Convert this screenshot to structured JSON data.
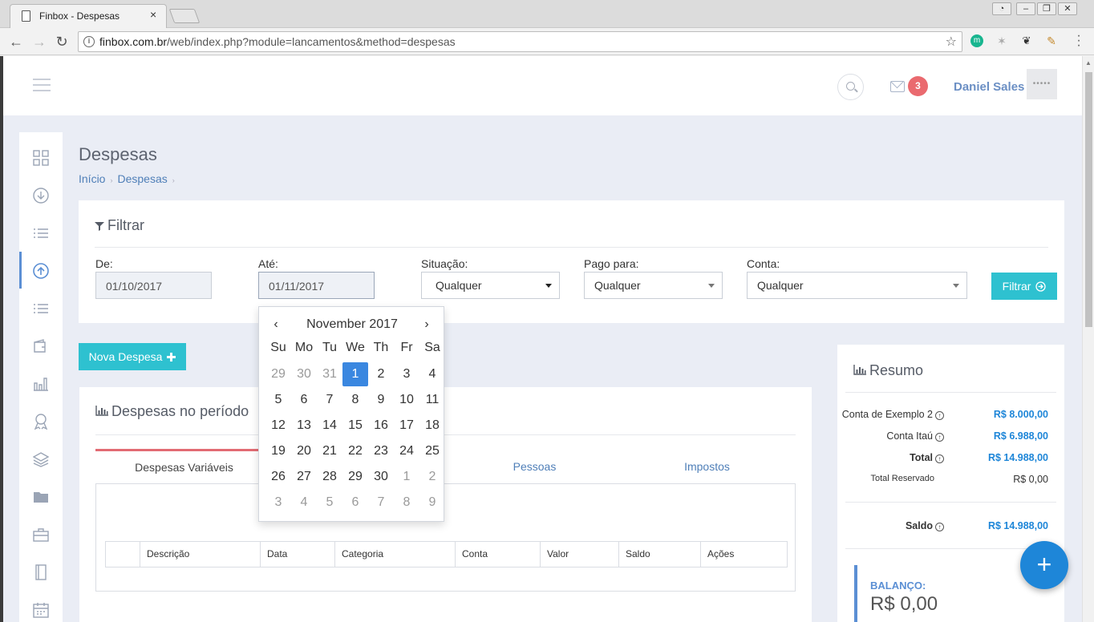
{
  "browser": {
    "tab_title": "Finbox - Despesas",
    "tab_close": "×",
    "url_host": "finbox.com.br",
    "url_path": "/web/index.php?module=lancamentos&method=despesas"
  },
  "header": {
    "notification_count": "3",
    "user_name": "Daniel Sales",
    "avatar_text": "•••••"
  },
  "page": {
    "title": "Despesas",
    "breadcrumb": [
      "Início",
      "Despesas"
    ]
  },
  "filter": {
    "title": "Filtrar",
    "de_label": "De:",
    "de_value": "01/10/2017",
    "ate_label": "Até:",
    "ate_value": "01/11/2017",
    "situacao_label": "Situação:",
    "situacao_value": "Qualquer",
    "pago_label": "Pago para:",
    "pago_value": "Qualquer",
    "conta_label": "Conta:",
    "conta_value": "Qualquer",
    "button": "Filtrar"
  },
  "nova_despesa": "Nova Despesa",
  "despesas_card": {
    "title": "Despesas no período",
    "tabs": [
      "Despesas Variáveis",
      "Pessoas",
      "Impostos"
    ],
    "columns": [
      "Descrição",
      "Data",
      "Categoria",
      "Conta",
      "Valor",
      "Saldo",
      "Ações"
    ]
  },
  "resumo": {
    "title": "Resumo",
    "rows": [
      {
        "label": "Conta de Exemplo 2",
        "value": "R$ 8.000,00"
      },
      {
        "label": "Conta Itaú",
        "value": "R$ 6.988,00"
      },
      {
        "label": "Total",
        "value": "R$ 14.988,00"
      },
      {
        "label": "Total Reservado",
        "value": "R$ 0,00"
      }
    ],
    "saldo_label": "Saldo",
    "saldo_value": "R$ 14.988,00",
    "balanco_label": "BALANÇO:",
    "balanco_value": "R$ 0,00"
  },
  "datepicker": {
    "month": "November 2017",
    "prev": "‹",
    "next": "›",
    "weekdays": [
      "Su",
      "Mo",
      "Tu",
      "We",
      "Th",
      "Fr",
      "Sa"
    ],
    "weeks": [
      [
        "29",
        "30",
        "31",
        "1",
        "2",
        "3",
        "4"
      ],
      [
        "5",
        "6",
        "7",
        "8",
        "9",
        "10",
        "11"
      ],
      [
        "12",
        "13",
        "14",
        "15",
        "16",
        "17",
        "18"
      ],
      [
        "19",
        "20",
        "21",
        "22",
        "23",
        "24",
        "25"
      ],
      [
        "26",
        "27",
        "28",
        "29",
        "30",
        "1",
        "2"
      ],
      [
        "3",
        "4",
        "5",
        "6",
        "7",
        "8",
        "9"
      ]
    ],
    "selected": "1"
  },
  "fab_label": "+",
  "colors": {
    "accent": "#2ec1d0",
    "link": "#4f7fb8",
    "value_blue": "#1e86d8",
    "badge": "#ea6a6f",
    "datepicker_active": "#3a87e0"
  },
  "sidebar_icons": [
    "dashboard-icon",
    "download-icon",
    "list-icon",
    "upload-icon",
    "list-icon",
    "wallet-icon",
    "bar-chart-icon",
    "award-icon",
    "layers-icon",
    "folder-icon",
    "briefcase-icon",
    "notebook-icon",
    "calendar-icon"
  ]
}
